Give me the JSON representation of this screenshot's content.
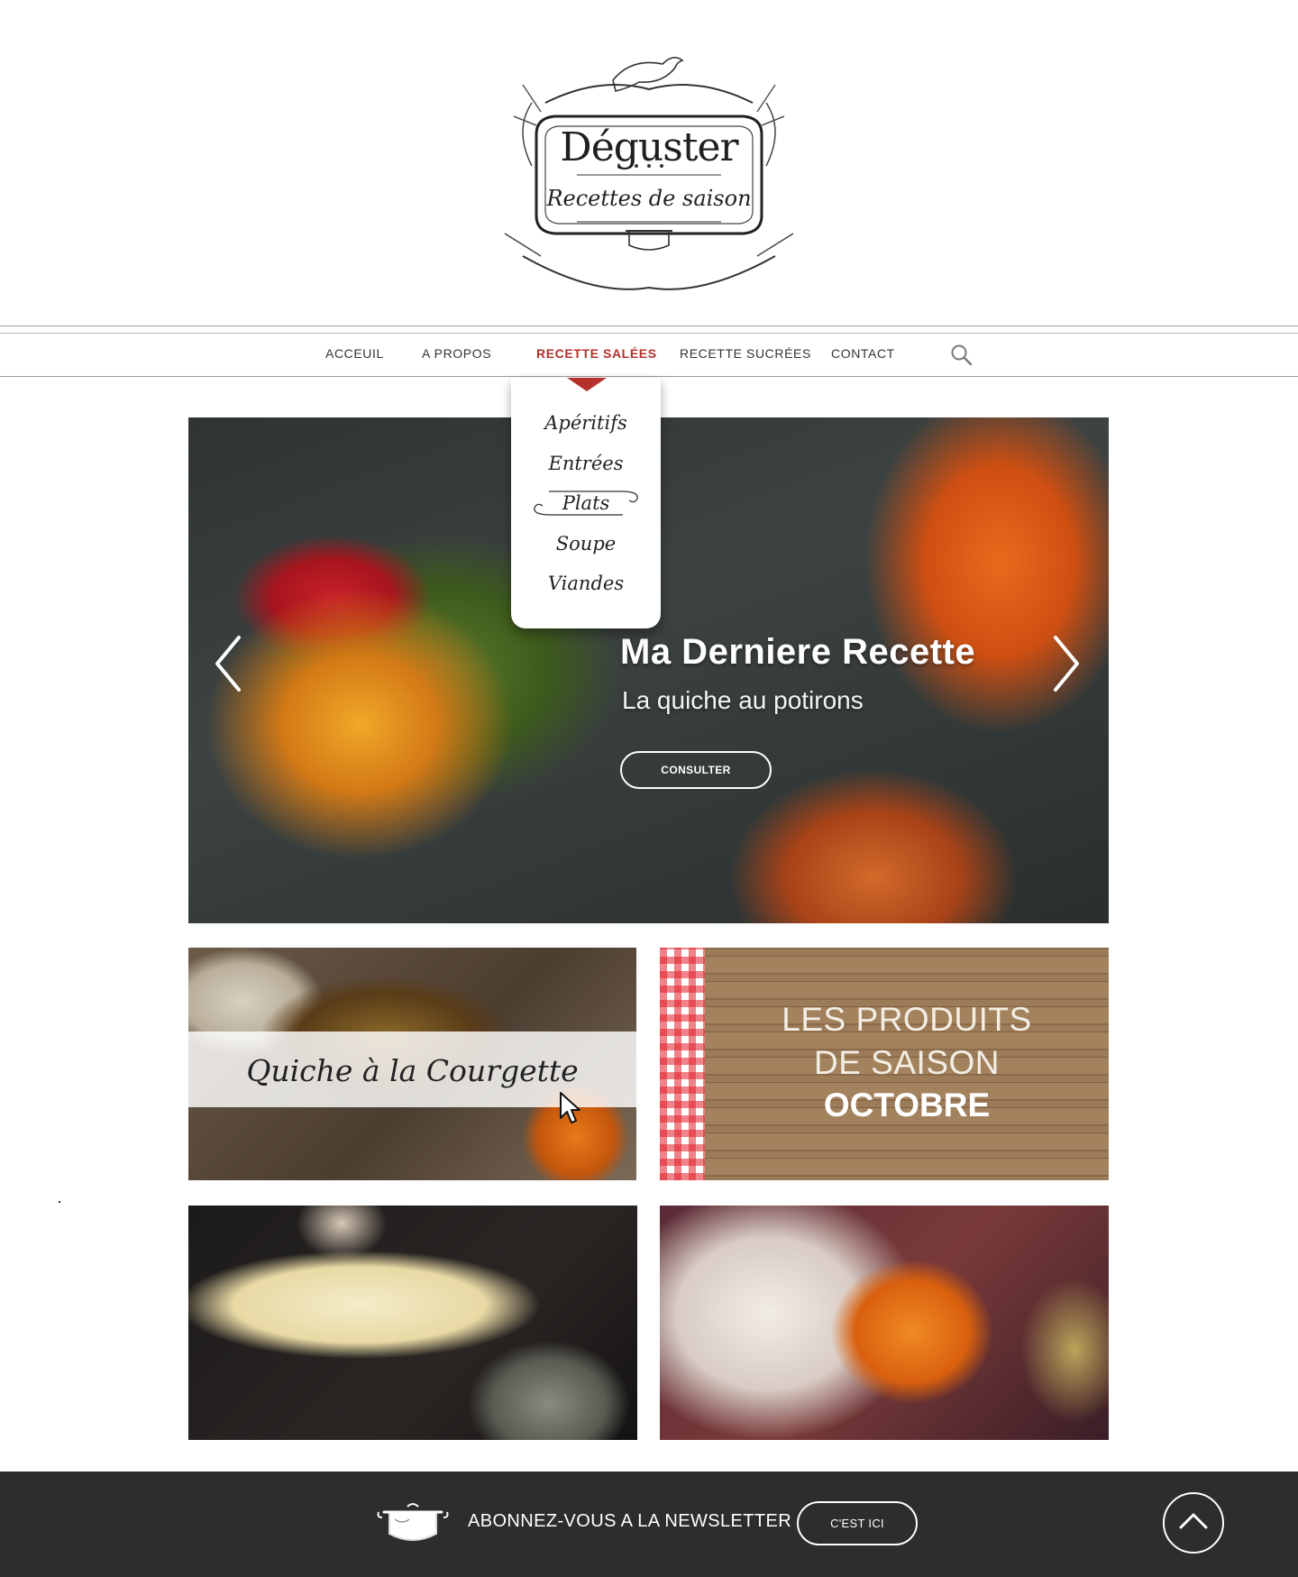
{
  "logo": {
    "title": "Déguster",
    "subtitle": "Recettes de saison"
  },
  "nav": {
    "items": [
      {
        "label": "ACCEUIL"
      },
      {
        "label": "A PROPOS"
      },
      {
        "label": "RECETTE SALÉES",
        "active": true
      },
      {
        "label": "RECETTE SUCRÉES"
      },
      {
        "label": "CONTACT"
      }
    ],
    "search_icon": "search-icon"
  },
  "dropdown": {
    "items": [
      "Apéritifs",
      "Entrées",
      "Plats",
      "Soupe",
      "Viandes"
    ],
    "highlighted": "Plats"
  },
  "hero": {
    "title": "Ma Derniere Recette",
    "subtitle": "La quiche au potirons",
    "button": "CONSULTER",
    "prev_icon": "chevron-left-icon",
    "next_icon": "chevron-right-icon"
  },
  "tiles": {
    "quiche_label": "Quiche à la Courgette",
    "produits_line1": "LES PRODUITS",
    "produits_line2": "DE SAISON",
    "produits_month": "OCTOBRE"
  },
  "footer": {
    "newsletter_text": "ABONNEZ-VOUS A LA NEWSLETTER",
    "button": "C'EST ICI",
    "to_top_icon": "chevron-up-icon",
    "pot_icon": "cooking-pot-icon"
  },
  "colors": {
    "accent": "#b5312c",
    "footer_bg": "#2d2d2d"
  }
}
